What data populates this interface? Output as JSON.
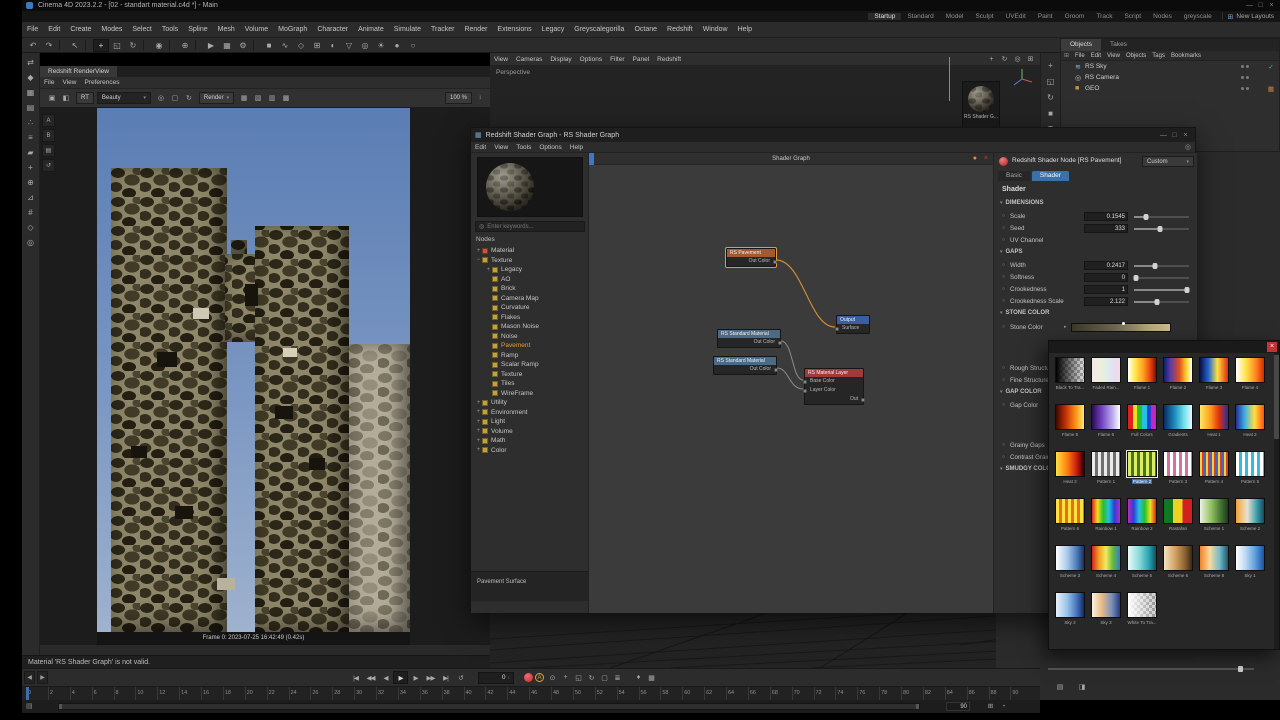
{
  "app": {
    "title": "Cinema 4D 2023.2.2 - [02 - standart material.c4d *] - Main",
    "window_buttons": [
      "—",
      "□",
      "×"
    ],
    "status_message": "Material 'RS Shader Graph' is not valid."
  },
  "layouts": {
    "tabs": [
      {
        "label": "Startup",
        "cls": "active"
      },
      {
        "label": "Standard"
      },
      {
        "label": "Model"
      },
      {
        "label": "Sculpt"
      },
      {
        "label": "UVEdit"
      },
      {
        "label": "Paint"
      },
      {
        "label": "Groom"
      },
      {
        "label": "Track"
      },
      {
        "label": "Script"
      },
      {
        "label": "Nodes"
      },
      {
        "label": "greyscale"
      }
    ],
    "new_layouts_icon": "⊞",
    "new_layouts_label": "New Layouts"
  },
  "menubar": [
    "File",
    "Edit",
    "Create",
    "Modes",
    "Select",
    "Tools",
    "Spline",
    "Mesh",
    "Volume",
    "MoGraph",
    "Character",
    "Animate",
    "Simulate",
    "Tracker",
    "Render",
    "Extensions",
    "Legacy",
    "Greyscalegorilla",
    "Octane",
    "Redshift",
    "Window",
    "Help"
  ],
  "toolbar": [
    {
      "n": "undo-icon",
      "g": "↶"
    },
    {
      "n": "redo-icon",
      "g": "↷"
    },
    {
      "n": "separator",
      "g": "",
      "cls": "sep"
    },
    {
      "n": "live-selection-icon",
      "g": "↖"
    },
    {
      "n": "separator",
      "g": "",
      "cls": "sep"
    },
    {
      "n": "move-icon",
      "g": "+",
      "cls": "on"
    },
    {
      "n": "scale-icon",
      "g": "◱"
    },
    {
      "n": "rotate-icon",
      "g": "↻"
    },
    {
      "n": "separator",
      "g": "",
      "cls": "sep"
    },
    {
      "n": "last-tool-icon",
      "g": "◉"
    },
    {
      "n": "separator",
      "g": "",
      "cls": "sep"
    },
    {
      "n": "coordinate-system-icon",
      "g": "⊕"
    },
    {
      "n": "separator",
      "g": "",
      "cls": "sep"
    },
    {
      "n": "render-view-icon",
      "g": "▶"
    },
    {
      "n": "render-picture-viewer-icon",
      "g": "▦"
    },
    {
      "n": "render-settings-icon",
      "g": "⚙"
    },
    {
      "n": "separator",
      "g": "",
      "cls": "sep"
    },
    {
      "n": "primitive-cube-icon",
      "g": "■"
    },
    {
      "n": "spline-pen-icon",
      "g": "∿"
    },
    {
      "n": "generators-icon",
      "g": "◇"
    },
    {
      "n": "mograph-icon",
      "g": "⊞"
    },
    {
      "n": "fields-icon",
      "g": "◐"
    },
    {
      "n": "deformers-icon",
      "g": "▽"
    },
    {
      "n": "camera-icon",
      "g": "◎"
    },
    {
      "n": "light-icon",
      "g": "☀"
    },
    {
      "n": "material-icon",
      "g": "●"
    },
    {
      "n": "sky-icon",
      "g": "○"
    }
  ],
  "leftbar": [
    {
      "n": "make-editable-icon",
      "g": "⇄"
    },
    {
      "n": "model-mode-icon",
      "g": "◆"
    },
    {
      "n": "texture-mode-icon",
      "g": "▦"
    },
    {
      "n": "workplane-mode-icon",
      "g": "▤"
    },
    {
      "n": "points-mode-icon",
      "g": "∴"
    },
    {
      "n": "edges-mode-icon",
      "g": "≡"
    },
    {
      "n": "polygons-mode-icon",
      "g": "▰"
    },
    {
      "n": "tweak-mode-icon",
      "g": "+"
    },
    {
      "n": "enable-axis-icon",
      "g": "⊕"
    },
    {
      "n": "snap-icon",
      "g": "⊿"
    },
    {
      "n": "quantize-icon",
      "g": "#"
    },
    {
      "n": "workplane-icon",
      "g": "◇"
    },
    {
      "n": "solo-icon",
      "g": "◎"
    }
  ],
  "viewport": {
    "menus": [
      "View",
      "Cameras",
      "Display",
      "Options",
      "Filter",
      "Panel",
      "Redshift"
    ],
    "right_icons": [
      {
        "n": "pan-icon",
        "g": "+"
      },
      {
        "n": "orbit-icon",
        "g": "↻"
      },
      {
        "n": "zoom-icon",
        "g": "◎"
      },
      {
        "n": "toggle-layout-icon",
        "g": "⊞"
      }
    ],
    "label": "Perspective",
    "material_tile_label": "RS Shader G..."
  },
  "renderview": {
    "tab": "Redshift RenderView",
    "menus": [
      "File",
      "View",
      "Preferences"
    ],
    "left_icons": [
      {
        "n": "snapshot-a-icon",
        "g": "A"
      },
      {
        "n": "snapshot-b-icon",
        "g": "B"
      },
      {
        "n": "layers-icon",
        "g": "▤"
      },
      {
        "n": "history-icon",
        "g": "↺"
      }
    ],
    "toolbar_icons_1": [
      {
        "n": "snapshot-icon",
        "g": "▣"
      },
      {
        "n": "ab-compare-icon",
        "g": "◧"
      }
    ],
    "rt_label": "RT",
    "beauty_label": "Beauty",
    "toolbar_icons_2": [
      {
        "n": "camera-lock-icon",
        "g": "◎"
      },
      {
        "n": "region-render-icon",
        "g": "▢"
      },
      {
        "n": "restart-render-icon",
        "g": "↻"
      }
    ],
    "render_label": "Render",
    "toolbar_icons_3": [
      {
        "n": "clay-mode-icon",
        "g": "▦"
      },
      {
        "n": "wireframe-icon",
        "g": "▧"
      },
      {
        "n": "aov-icon",
        "g": "▥"
      },
      {
        "n": "bucket-icon",
        "g": "▩"
      }
    ],
    "zoom_label": "100 %",
    "footer": "Frame 0: 2023-07-25 16:42:49 (0.42s)",
    "sky_style": "background:linear-gradient(180deg,#5a7db4 0%,#7b97c2 55%,#9fb2ce 100%)"
  },
  "sidestrip": [
    {
      "n": "move-tool-icon",
      "g": "+"
    },
    {
      "n": "scale-tool-icon",
      "g": "◱"
    },
    {
      "n": "rotate-tool-icon",
      "g": "↻"
    },
    {
      "n": "cube-icon",
      "g": "■"
    },
    {
      "n": "text-tool-icon",
      "g": "T"
    },
    {
      "n": "target-icon",
      "g": "◎"
    }
  ],
  "object_manager": {
    "tabs": [
      {
        "label": "Objects",
        "cls": "active"
      },
      {
        "label": "Takes"
      }
    ],
    "menus": [
      "File",
      "Edit",
      "View",
      "Objects",
      "Tags",
      "Bookmarks"
    ],
    "items": [
      {
        "label": "RS Sky",
        "icon_glyph": "≋",
        "icon_color": "#8fb2dd",
        "tag_glyph": "✓",
        "tag_color": "#55c555"
      },
      {
        "label": "RS Camera",
        "icon_glyph": "◎",
        "icon_color": "#b8b8b8",
        "tag_glyph": "",
        "tag_color": ""
      },
      {
        "label": "GEO",
        "icon_glyph": "■",
        "icon_color": "#d09345",
        "tag_glyph": "▦",
        "tag_color": "#c8873a"
      }
    ]
  },
  "shader_graph": {
    "title": "Redshift Shader Graph - RS Shader Graph",
    "window_buttons": [
      "—",
      "□",
      "×"
    ],
    "menus": [
      "Edit",
      "View",
      "Tools",
      "Options",
      "Help"
    ],
    "search_placeholder": "Enter keywords...",
    "nodes_heading": "Nodes",
    "tree": [
      {
        "label": "Material",
        "ind": "2px",
        "exp": "+",
        "sq": "#c05a3a",
        "cls": ""
      },
      {
        "label": "Texture",
        "ind": "2px",
        "exp": "−",
        "sq": "#c2a23c",
        "cls": ""
      },
      {
        "label": "Legacy",
        "ind": "12px",
        "exp": "+",
        "sq": "#c2a23c",
        "cls": ""
      },
      {
        "label": "AO",
        "ind": "12px",
        "exp": "",
        "sq": "#c2a23c",
        "cls": ""
      },
      {
        "label": "Brick",
        "ind": "12px",
        "exp": "",
        "sq": "#c2a23c",
        "cls": ""
      },
      {
        "label": "Camera Map",
        "ind": "12px",
        "exp": "",
        "sq": "#c2a23c",
        "cls": ""
      },
      {
        "label": "Curvature",
        "ind": "12px",
        "exp": "",
        "sq": "#c2a23c",
        "cls": ""
      },
      {
        "label": "Flakes",
        "ind": "12px",
        "exp": "",
        "sq": "#c2a23c",
        "cls": ""
      },
      {
        "label": "Mason Noise",
        "ind": "12px",
        "exp": "",
        "sq": "#c2a23c",
        "cls": ""
      },
      {
        "label": "Noise",
        "ind": "12px",
        "exp": "",
        "sq": "#c2a23c",
        "cls": ""
      },
      {
        "label": "Pavement",
        "ind": "12px",
        "exp": "",
        "sq": "#c2a23c",
        "cls": "active"
      },
      {
        "label": "Ramp",
        "ind": "12px",
        "exp": "",
        "sq": "#c2a23c",
        "cls": ""
      },
      {
        "label": "Scalar Ramp",
        "ind": "12px",
        "exp": "",
        "sq": "#c2a23c",
        "cls": ""
      },
      {
        "label": "Texture",
        "ind": "12px",
        "exp": "",
        "sq": "#c2a23c",
        "cls": ""
      },
      {
        "label": "Tiles",
        "ind": "12px",
        "exp": "",
        "sq": "#c2a23c",
        "cls": ""
      },
      {
        "label": "WireFrame",
        "ind": "12px",
        "exp": "",
        "sq": "#c2a23c",
        "cls": ""
      },
      {
        "label": "Utility",
        "ind": "2px",
        "exp": "+",
        "sq": "#c2a23c",
        "cls": ""
      },
      {
        "label": "Environment",
        "ind": "2px",
        "exp": "+",
        "sq": "#c2a23c",
        "cls": ""
      },
      {
        "label": "Light",
        "ind": "2px",
        "exp": "+",
        "sq": "#c2a23c",
        "cls": ""
      },
      {
        "label": "Volume",
        "ind": "2px",
        "exp": "+",
        "sq": "#c2a23c",
        "cls": ""
      },
      {
        "label": "Math",
        "ind": "2px",
        "exp": "+",
        "sq": "#c2a23c",
        "cls": ""
      },
      {
        "label": "Color",
        "ind": "2px",
        "exp": "+",
        "sq": "#c2a23c",
        "cls": ""
      }
    ],
    "status": "Pavement Surface",
    "graph_tab": "Shader Graph",
    "nodes": {
      "pavement": {
        "title": "RS Pavement",
        "port": "Out Color",
        "header_style": "background:#a25a34"
      },
      "output": {
        "title": "Output",
        "port": "Surface",
        "header_style": "background:#3a5fa0"
      },
      "std1": {
        "title": "RS Standard Material",
        "port": "Out Color",
        "header_style": "background:#4a6a85"
      },
      "std2": {
        "title": "RS Standard Material",
        "port": "Out Color",
        "header_style": "background:#4a6a85"
      },
      "layer": {
        "title": "RS Material Layer",
        "port_in1": "Base Color",
        "port_in2": "Layer Color",
        "port_out": "Out",
        "header_style": "background:#a03a3a"
      }
    }
  },
  "attributes": {
    "title": "Redshift Shader Node [RS Pavement]",
    "preset": "Custom",
    "tabs": [
      {
        "label": "Basic",
        "cls": ""
      },
      {
        "label": "Shader",
        "cls": "active"
      }
    ],
    "heading": "Shader",
    "sec_dimensions": "DIMENSIONS",
    "dims": [
      {
        "label": "Scale",
        "value": "0.1545",
        "pct": "22%"
      },
      {
        "label": "Seed",
        "value": "333",
        "pct": "48%"
      }
    ],
    "uv_label": "UV Channel",
    "sec_gaps": "GAPS",
    "gaps": [
      {
        "label": "Width",
        "value": "0.2417",
        "pct": "38%"
      },
      {
        "label": "Softness",
        "value": "0",
        "pct": "3%"
      },
      {
        "label": "Crookedness",
        "value": "1",
        "pct": "97%"
      },
      {
        "label": "Crookedness Scale",
        "value": "2.122",
        "pct": "42%"
      }
    ],
    "sec_stone": "STONE COLOR",
    "stone_label": "Stone Color",
    "stone_gradient_style": "background:linear-gradient(90deg,#3b382b 0%,#6e6850 45%,#b2a378 78%,#cabc8f 100%)",
    "extra_stone": [
      {
        "label": "Rough Structure"
      },
      {
        "label": "Fine Structure"
      }
    ],
    "sec_gapcolor": "GAP COLOR",
    "gapcolor_label": "Gap Color",
    "extra_gap": [
      {
        "label": "Grainy Gaps"
      },
      {
        "label": "Contrast Grain"
      }
    ],
    "sec_smudgy": "SMUDGY COLOR"
  },
  "gradient_picker": {
    "presets": [
      {
        "name": "Black To Tra...",
        "css": "linear-gradient(90deg,#000 0%,rgba(0,0,0,0) 92%),repeating-conic-gradient(#9a9a9a 0% 25%,#d2d2d2 0% 50%)",
        "cls": ""
      },
      {
        "name": "Faded Rain...",
        "css": "linear-gradient(90deg,#efe9e9,#f3ecdc,#e7f0dc,#dcebf0,#e9dcf0,#f0dce4)",
        "cls": ""
      },
      {
        "name": "Flame 1",
        "css": "linear-gradient(90deg,#fff,#ffe84d 25%,#ff9e1f 55%,#e03c0e 82%,#7a1000)",
        "cls": ""
      },
      {
        "name": "Flame 2",
        "css": "linear-gradient(90deg,#0c1f70,#5a3aa8 22%,#e04f1e 55%,#ffd42a 80%,#fff)",
        "cls": ""
      },
      {
        "name": "Flame 3",
        "css": "linear-gradient(90deg,#081048,#2a6ad0 32%,#ffe040 62%,#e02a10)",
        "cls": ""
      },
      {
        "name": "Flame 4",
        "css": "linear-gradient(90deg,#fff,#ffe040 38%,#ff8020 72%,#d02a00)",
        "cls": ""
      },
      {
        "name": "Flame 5",
        "css": "linear-gradient(90deg,#3c0800,#c23108 35%,#ff9212 70%,#ffe873)",
        "cls": ""
      },
      {
        "name": "Flame 6",
        "css": "linear-gradient(90deg,#2a0a52,#7243c2 35%,#b2a2ea 70%,#fff)",
        "cls": ""
      },
      {
        "name": "Full Colors",
        "css": "linear-gradient(90deg,#e02020 0 17%,#f0e020 17% 33%,#27c027 33% 50%,#27c0e0 50% 67%,#2742d2 67% 83%,#c227c2 83% 100%)",
        "cls": ""
      },
      {
        "name": "Gradients",
        "css": "linear-gradient(90deg,#0a2a62,#1e90c2 40%,#72e2ea 72%,#eaf8ff)",
        "cls": ""
      },
      {
        "name": "Heat 1",
        "css": "linear-gradient(90deg,#ffe95e,#ff9a1e 38%,#e03010 68%,#20309a)",
        "cls": ""
      },
      {
        "name": "Heat 2",
        "css": "linear-gradient(90deg,#20309a,#40b2e2 32%,#ffe040 66%,#ff5010)",
        "cls": ""
      },
      {
        "name": "Heat 3",
        "css": "linear-gradient(90deg,#ffe040,#ff8010 40%,#c21810 76%,#2a0000)",
        "cls": ""
      },
      {
        "name": "Pattern 1",
        "css": "repeating-linear-gradient(90deg,#eaeaea 0 3px,#6e6e6e 3px 6px)",
        "cls": ""
      },
      {
        "name": "Pattern 2",
        "css": "repeating-linear-gradient(90deg,#dcec62 0 3px,#48741f 3px 6px)",
        "cls": "selected"
      },
      {
        "name": "Pattern 3",
        "css": "repeating-linear-gradient(90deg,#fff 0 3px,#d272a2 3px 6px)",
        "cls": ""
      },
      {
        "name": "Pattern 4",
        "css": "repeating-linear-gradient(90deg,#f2d242 0 2px,#d24228 2px 4px,#3a6ac2 4px 6px)",
        "cls": ""
      },
      {
        "name": "Pattern 5",
        "css": "repeating-linear-gradient(90deg,#fff 0 3px,#3abada 3px 6px)",
        "cls": ""
      },
      {
        "name": "Pattern 6",
        "css": "repeating-linear-gradient(90deg,#ffe040 0 3px,#e27212 3px 6px)",
        "cls": ""
      },
      {
        "name": "Rainbow 1",
        "css": "linear-gradient(90deg,#e02020,#f0e020,#27c027,#27c0e0,#2742d2,#c227c2)",
        "cls": ""
      },
      {
        "name": "Rainbow 2",
        "css": "linear-gradient(90deg,#c227c2,#2742d2,#27c0e0,#27c027,#f0e020,#e02020)",
        "cls": ""
      },
      {
        "name": "Rastafari",
        "css": "linear-gradient(90deg,#107820 0 33%,#f0d020 33% 66%,#d02020 66% 100%)",
        "cls": ""
      },
      {
        "name": "Scheme 1",
        "css": "linear-gradient(90deg,#eaf2e2,#92c262 40%,#427232 75%,#1e3a16)",
        "cls": ""
      },
      {
        "name": "Scheme 2",
        "css": "linear-gradient(90deg,#f2a232,#eae2d2 40%,#3a9aaa 75%,#164a5a)",
        "cls": ""
      },
      {
        "name": "Scheme 3",
        "css": "linear-gradient(90deg,#fff,#aacaea 40%,#4a7aba 75%,#163058)",
        "cls": ""
      },
      {
        "name": "Scheme 4",
        "css": "linear-gradient(90deg,#d22222,#f2a222 25%,#f2ea62 50%,#62ba3a 75%,#3a7aca)",
        "cls": ""
      },
      {
        "name": "Scheme 5",
        "css": "linear-gradient(90deg,#eafafa,#8adada 40%,#2aa2b2 75%,#0e505e)",
        "cls": ""
      },
      {
        "name": "Scheme 6",
        "css": "linear-gradient(90deg,#f2e2c2,#d2a262 40%,#8a6232 75%,#3a2812)",
        "cls": ""
      },
      {
        "name": "Scheme 8",
        "css": "linear-gradient(90deg,#f28222,#f8daa2 35%,#72baca 70%,#1e5868)",
        "cls": ""
      },
      {
        "name": "Sky 1",
        "css": "linear-gradient(90deg,#fff,#bad8f2 35%,#5a9ada 70%,#1a52a2)",
        "cls": ""
      },
      {
        "name": "Sky 2",
        "css": "linear-gradient(90deg,#eaf2fa,#9ac2ea 40%,#4272ba 75%,#102a62)",
        "cls": ""
      },
      {
        "name": "Sky 3",
        "css": "linear-gradient(90deg,#faf2e2,#eaba82 35%,#7a92ba 70%,#2a3a7a)",
        "cls": ""
      },
      {
        "name": "White To Tra...",
        "css": "linear-gradient(90deg,#fff 0%,rgba(255,255,255,0) 92%),repeating-conic-gradient(#9a9a9a 0% 25%,#d2d2d2 0% 50%)",
        "cls": ""
      }
    ]
  },
  "timeline": {
    "scroll_left": "◀",
    "scroll_right": "▶",
    "transport": [
      {
        "n": "goto-start-button",
        "g": "|◀"
      },
      {
        "n": "previous-key-button",
        "g": "◀◀"
      },
      {
        "n": "previous-frame-button",
        "g": "◀"
      },
      {
        "n": "play-forwards-button",
        "g": "▶",
        "cls": "on"
      },
      {
        "n": "next-frame-button",
        "g": "▶"
      },
      {
        "n": "next-key-button",
        "g": "▶▶"
      },
      {
        "n": "goto-end-button",
        "g": "▶|"
      },
      {
        "n": "loop-button",
        "g": "↺"
      }
    ],
    "frame_value": "0",
    "autokey_label": "A",
    "record_icons": [
      {
        "n": "keyframe-record-button",
        "g": "⊙"
      },
      {
        "n": "record-position-button",
        "g": "+"
      },
      {
        "n": "record-scale-button",
        "g": "◱"
      },
      {
        "n": "record-rotation-button",
        "g": "↻"
      },
      {
        "n": "record-parameter-button",
        "g": "▢"
      },
      {
        "n": "record-pla-button",
        "g": "≣"
      }
    ],
    "key_icons": [
      {
        "n": "keyframe-selection-button",
        "g": "♦"
      },
      {
        "n": "marker-button",
        "g": "▦"
      }
    ],
    "ticks": [
      "0",
      "2",
      "4",
      "6",
      "8",
      "10",
      "12",
      "14",
      "16",
      "18",
      "20",
      "22",
      "24",
      "26",
      "28",
      "30",
      "32",
      "34",
      "36",
      "38",
      "40",
      "42",
      "44",
      "46",
      "48",
      "50",
      "52",
      "54",
      "56",
      "58",
      "60",
      "62",
      "64",
      "66",
      "68",
      "70",
      "72",
      "74",
      "76",
      "78",
      "80",
      "82",
      "84",
      "86",
      "88",
      "90"
    ],
    "end_value": "90",
    "range_icons": [
      {
        "n": "frame-all-button",
        "g": "⊞"
      },
      {
        "n": "time-button",
        "g": "◔"
      }
    ]
  }
}
